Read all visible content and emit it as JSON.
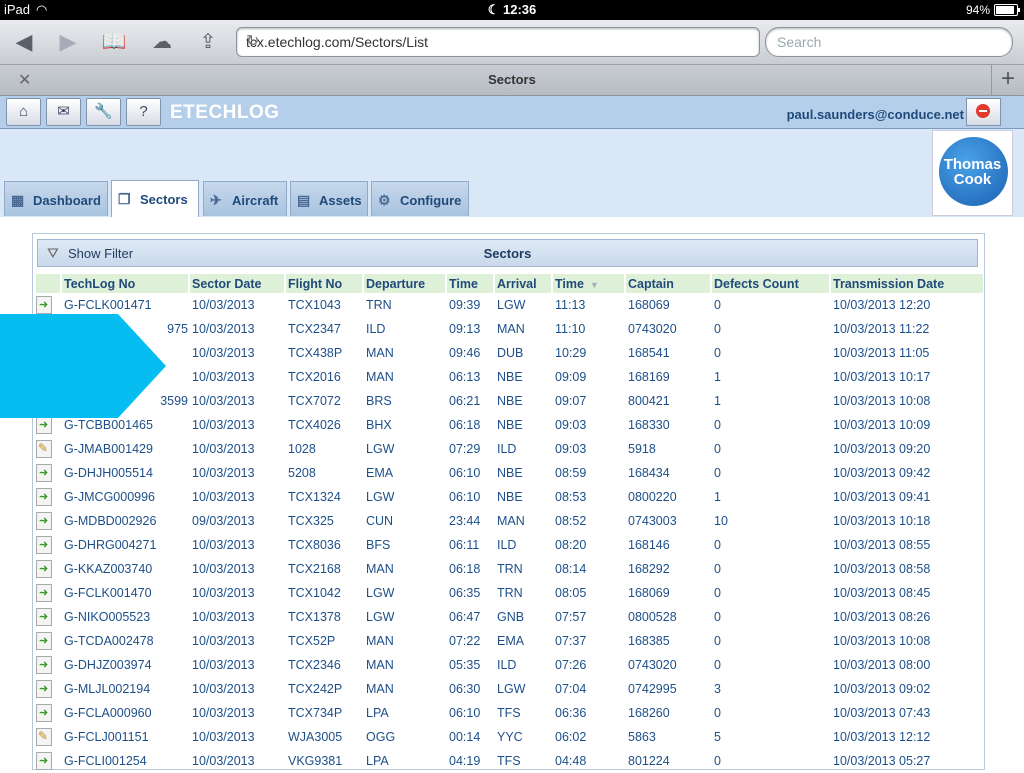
{
  "status": {
    "device": "iPad",
    "time": "12:36",
    "battery": "94%"
  },
  "browser": {
    "url": "tcx.etechlog.com/Sectors/List",
    "search_placeholder": "Search",
    "tab_title": "Sectors"
  },
  "app": {
    "brand": "ETECHLOG",
    "user": "paul.saunders@conduce.net",
    "logo_line1": "Thomas",
    "logo_line2": "Cook",
    "nav": [
      "Dashboard",
      "Sectors",
      "Aircraft",
      "Assets",
      "Configure"
    ],
    "show_filter": "Show Filter",
    "panel_title": "Sectors"
  },
  "columns": [
    "TechLog No",
    "Sector Date",
    "Flight No",
    "Departure",
    "Time",
    "Arrival",
    "Time",
    "Captain",
    "Defects Count",
    "Transmission Date"
  ],
  "rows": [
    {
      "icon": "go",
      "c": [
        "G-FCLK001471",
        "10/03/2013",
        "TCX1043",
        "TRN",
        "09:39",
        "LGW",
        "11:13",
        "168069",
        "0",
        "10/03/2013 12:20"
      ]
    },
    {
      "icon": "go",
      "c": [
        "975",
        "10/03/2013",
        "TCX2347",
        "ILD",
        "09:13",
        "MAN",
        "11:10",
        "0743020",
        "0",
        "10/03/2013 11:22"
      ]
    },
    {
      "icon": "go",
      "c": [
        "",
        "10/03/2013",
        "TCX438P",
        "MAN",
        "09:46",
        "DUB",
        "10:29",
        "168541",
        "0",
        "10/03/2013 11:05"
      ]
    },
    {
      "icon": "go",
      "c": [
        "",
        "10/03/2013",
        "TCX2016",
        "MAN",
        "06:13",
        "NBE",
        "09:09",
        "168169",
        "1",
        "10/03/2013 10:17"
      ]
    },
    {
      "icon": "go",
      "c": [
        "3599",
        "10/03/2013",
        "TCX7072",
        "BRS",
        "06:21",
        "NBE",
        "09:07",
        "800421",
        "1",
        "10/03/2013 10:08"
      ]
    },
    {
      "icon": "go",
      "c": [
        "G-TCBB001465",
        "10/03/2013",
        "TCX4026",
        "BHX",
        "06:18",
        "NBE",
        "09:03",
        "168330",
        "0",
        "10/03/2013 10:09"
      ]
    },
    {
      "icon": "edit",
      "c": [
        "G-JMAB001429",
        "10/03/2013",
        "1028",
        "LGW",
        "07:29",
        "ILD",
        "09:03",
        "5918",
        "0",
        "10/03/2013 09:20"
      ]
    },
    {
      "icon": "go",
      "c": [
        "G-DHJH005514",
        "10/03/2013",
        "5208",
        "EMA",
        "06:10",
        "NBE",
        "08:59",
        "168434",
        "0",
        "10/03/2013 09:42"
      ]
    },
    {
      "icon": "go",
      "c": [
        "G-JMCG000996",
        "10/03/2013",
        "TCX1324",
        "LGW",
        "06:10",
        "NBE",
        "08:53",
        "0800220",
        "1",
        "10/03/2013 09:41"
      ]
    },
    {
      "icon": "go",
      "c": [
        "G-MDBD002926",
        "09/03/2013",
        "TCX325",
        "CUN",
        "23:44",
        "MAN",
        "08:52",
        "0743003",
        "10",
        "10/03/2013 10:18"
      ]
    },
    {
      "icon": "go",
      "c": [
        "G-DHRG004271",
        "10/03/2013",
        "TCX8036",
        "BFS",
        "06:11",
        "ILD",
        "08:20",
        "168146",
        "0",
        "10/03/2013 08:55"
      ]
    },
    {
      "icon": "go",
      "c": [
        "G-KKAZ003740",
        "10/03/2013",
        "TCX2168",
        "MAN",
        "06:18",
        "TRN",
        "08:14",
        "168292",
        "0",
        "10/03/2013 08:58"
      ]
    },
    {
      "icon": "go",
      "c": [
        "G-FCLK001470",
        "10/03/2013",
        "TCX1042",
        "LGW",
        "06:35",
        "TRN",
        "08:05",
        "168069",
        "0",
        "10/03/2013 08:45"
      ]
    },
    {
      "icon": "go",
      "c": [
        "G-NIKO005523",
        "10/03/2013",
        "TCX1378",
        "LGW",
        "06:47",
        "GNB",
        "07:57",
        "0800528",
        "0",
        "10/03/2013 08:26"
      ]
    },
    {
      "icon": "go",
      "c": [
        "G-TCDA002478",
        "10/03/2013",
        "TCX52P",
        "MAN",
        "07:22",
        "EMA",
        "07:37",
        "168385",
        "0",
        "10/03/2013 10:08"
      ]
    },
    {
      "icon": "go",
      "c": [
        "G-DHJZ003974",
        "10/03/2013",
        "TCX2346",
        "MAN",
        "05:35",
        "ILD",
        "07:26",
        "0743020",
        "0",
        "10/03/2013 08:00"
      ]
    },
    {
      "icon": "go",
      "c": [
        "G-MLJL002194",
        "10/03/2013",
        "TCX242P",
        "MAN",
        "06:30",
        "LGW",
        "07:04",
        "0742995",
        "3",
        "10/03/2013 09:02"
      ]
    },
    {
      "icon": "go",
      "c": [
        "G-FCLA000960",
        "10/03/2013",
        "TCX734P",
        "LPA",
        "06:10",
        "TFS",
        "06:36",
        "168260",
        "0",
        "10/03/2013 07:43"
      ]
    },
    {
      "icon": "edit",
      "c": [
        "G-FCLJ001151",
        "10/03/2013",
        "WJA3005",
        "OGG",
        "00:14",
        "YYC",
        "06:02",
        "5863",
        "5",
        "10/03/2013 12:12"
      ]
    },
    {
      "icon": "go",
      "c": [
        "G-FCLI001254",
        "10/03/2013",
        "VKG9381",
        "LPA",
        "04:19",
        "TFS",
        "04:48",
        "801224",
        "0",
        "10/03/2013 05:27"
      ]
    }
  ]
}
